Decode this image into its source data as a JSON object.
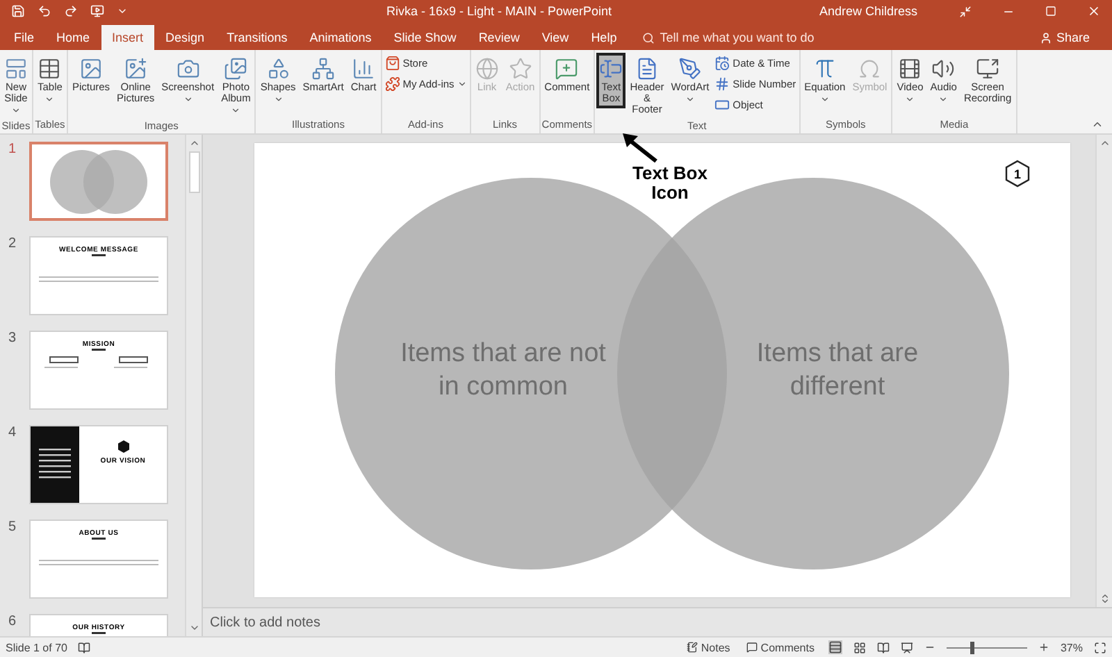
{
  "window": {
    "title": "Rivka - 16x9 - Light - MAIN - PowerPoint",
    "user": "Andrew Childress"
  },
  "tabs": [
    {
      "label": "File",
      "selected": false
    },
    {
      "label": "Home",
      "selected": false
    },
    {
      "label": "Insert",
      "selected": true
    },
    {
      "label": "Design",
      "selected": false
    },
    {
      "label": "Transitions",
      "selected": false
    },
    {
      "label": "Animations",
      "selected": false
    },
    {
      "label": "Slide Show",
      "selected": false
    },
    {
      "label": "Review",
      "selected": false
    },
    {
      "label": "View",
      "selected": false
    },
    {
      "label": "Help",
      "selected": false
    }
  ],
  "tell_me": {
    "placeholder": "Tell me what you want to do"
  },
  "share": "Share",
  "ribbon": {
    "groups": [
      {
        "label": "Slides",
        "items": [
          {
            "kind": "large",
            "label": "New Slide",
            "dropdown": true,
            "disabled": false,
            "selected": false
          }
        ]
      },
      {
        "label": "Tables",
        "items": [
          {
            "kind": "large",
            "label": "Table",
            "dropdown": true,
            "disabled": false,
            "selected": false
          }
        ]
      },
      {
        "label": "Images",
        "items": [
          {
            "kind": "large",
            "label": "Pictures",
            "dropdown": false,
            "disabled": false,
            "selected": false
          },
          {
            "kind": "large",
            "label": "Online Pictures",
            "dropdown": false,
            "disabled": false,
            "selected": false
          },
          {
            "kind": "large",
            "label": "Screenshot",
            "dropdown": true,
            "disabled": false,
            "selected": false
          },
          {
            "kind": "large",
            "label": "Photo Album",
            "dropdown": true,
            "disabled": false,
            "selected": false
          }
        ]
      },
      {
        "label": "Illustrations",
        "items": [
          {
            "kind": "large",
            "label": "Shapes",
            "dropdown": true,
            "disabled": false,
            "selected": false
          },
          {
            "kind": "large",
            "label": "SmartArt",
            "dropdown": false,
            "disabled": false,
            "selected": false
          },
          {
            "kind": "large",
            "label": "Chart",
            "dropdown": false,
            "disabled": false,
            "selected": false
          }
        ]
      },
      {
        "label": "Add-ins",
        "items": [
          {
            "kind": "small",
            "label": "Store",
            "dropdown": false,
            "disabled": false,
            "selected": false
          },
          {
            "kind": "small",
            "label": "My Add-ins",
            "dropdown": true,
            "disabled": false,
            "selected": false
          }
        ]
      },
      {
        "label": "Links",
        "items": [
          {
            "kind": "large",
            "label": "Link",
            "dropdown": false,
            "disabled": true,
            "selected": false
          },
          {
            "kind": "large",
            "label": "Action",
            "dropdown": false,
            "disabled": true,
            "selected": false
          }
        ]
      },
      {
        "label": "Comments",
        "items": [
          {
            "kind": "large",
            "label": "Comment",
            "dropdown": false,
            "disabled": false,
            "selected": false
          }
        ]
      },
      {
        "label": "Text",
        "items": [
          {
            "kind": "large",
            "label": "Text Box",
            "dropdown": false,
            "disabled": false,
            "selected": true
          },
          {
            "kind": "large",
            "label": "Header & Footer",
            "dropdown": false,
            "disabled": false,
            "selected": false
          },
          {
            "kind": "large",
            "label": "WordArt",
            "dropdown": true,
            "disabled": false,
            "selected": false
          },
          {
            "kind": "small",
            "label": "Date & Time",
            "dropdown": false,
            "disabled": false,
            "selected": false
          },
          {
            "kind": "small",
            "label": "Slide Number",
            "dropdown": false,
            "disabled": false,
            "selected": false
          },
          {
            "kind": "small",
            "label": "Object",
            "dropdown": false,
            "disabled": false,
            "selected": false
          }
        ]
      },
      {
        "label": "Symbols",
        "items": [
          {
            "kind": "large",
            "label": "Equation",
            "dropdown": true,
            "disabled": false,
            "selected": false
          },
          {
            "kind": "large",
            "label": "Symbol",
            "dropdown": false,
            "disabled": true,
            "selected": false
          }
        ]
      },
      {
        "label": "Media",
        "items": [
          {
            "kind": "large",
            "label": "Video",
            "dropdown": true,
            "disabled": false,
            "selected": false
          },
          {
            "kind": "large",
            "label": "Audio",
            "dropdown": true,
            "disabled": false,
            "selected": false
          },
          {
            "kind": "large",
            "label": "Screen Recording",
            "dropdown": false,
            "disabled": false,
            "selected": false
          }
        ]
      }
    ]
  },
  "annotation": {
    "text": "Text Box Icon"
  },
  "thumbnails": [
    {
      "number": "1",
      "kind": "venn",
      "selected": true
    },
    {
      "number": "2",
      "kind": "text",
      "title": "WELCOME MESSAGE",
      "selected": false
    },
    {
      "number": "3",
      "kind": "columns",
      "title": "MISSION",
      "selected": false
    },
    {
      "number": "4",
      "kind": "dark",
      "title": "OUR VISION",
      "selected": false
    },
    {
      "number": "5",
      "kind": "text",
      "title": "ABOUT US",
      "selected": false
    },
    {
      "number": "6",
      "kind": "text",
      "title": "OUR HISTORY",
      "selected": false
    }
  ],
  "slide": {
    "left_label": "Items that are not in common",
    "right_label": "Items that are different",
    "badge": "1"
  },
  "notes": {
    "placeholder": "Click to add notes"
  },
  "status_bar": {
    "slide": "Slide 1 of 70",
    "notes": "Notes",
    "comments": "Comments",
    "zoom": "37%",
    "zoom_level": {
      "level": 0.3
    }
  }
}
